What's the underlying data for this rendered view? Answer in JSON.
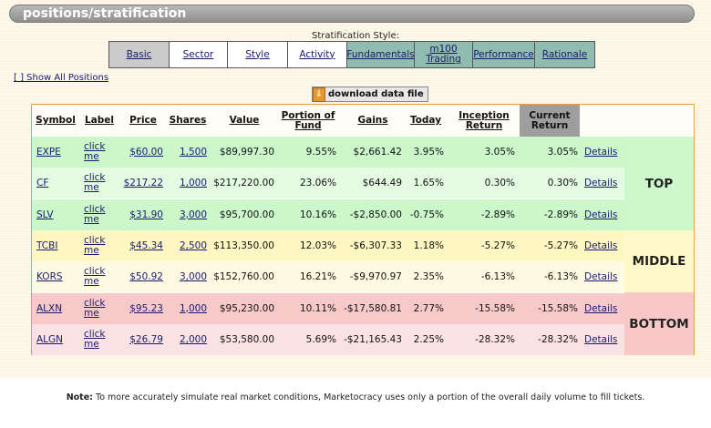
{
  "title": "positions/stratification",
  "stratification": {
    "label": "Stratification Style:",
    "tabs": [
      "Basic",
      "Sector",
      "Style",
      "Activity",
      "Fundamentals",
      "m100 Trading",
      "Performance",
      "Rationale"
    ],
    "selected": "Basic"
  },
  "show_all": "[ ] Show All Positions",
  "download_label": "download data file",
  "columns": [
    "Symbol",
    "Label",
    "Price",
    "Shares",
    "Value",
    "Portion of Fund",
    "Gains",
    "Today",
    "Inception Return",
    "Current Return"
  ],
  "rows": [
    {
      "symbol": "EXPE",
      "label": "click me",
      "price": "$60.00",
      "shares": "1,500",
      "value": "$89,997.30",
      "portion": "9.55%",
      "gains": "$2,661.42",
      "today": "3.95%",
      "inception": "3.05%",
      "current": "3.05%",
      "details": "Details"
    },
    {
      "symbol": "CF",
      "label": "click me",
      "price": "$217.22",
      "shares": "1,000",
      "value": "$217,220.00",
      "portion": "23.06%",
      "gains": "$644.49",
      "today": "1.65%",
      "inception": "0.30%",
      "current": "0.30%",
      "details": "Details"
    },
    {
      "symbol": "SLV",
      "label": "click me",
      "price": "$31.90",
      "shares": "3,000",
      "value": "$95,700.00",
      "portion": "10.16%",
      "gains": "-$2,850.00",
      "today": "-0.75%",
      "inception": "-2.89%",
      "current": "-2.89%",
      "details": "Details"
    },
    {
      "symbol": "TCBI",
      "label": "click me",
      "price": "$45.34",
      "shares": "2,500",
      "value": "$113,350.00",
      "portion": "12.03%",
      "gains": "-$6,307.33",
      "today": "1.18%",
      "inception": "-5.27%",
      "current": "-5.27%",
      "details": "Details"
    },
    {
      "symbol": "KORS",
      "label": "click me",
      "price": "$50.92",
      "shares": "3,000",
      "value": "$152,760.00",
      "portion": "16.21%",
      "gains": "-$9,970.97",
      "today": "2.35%",
      "inception": "-6.13%",
      "current": "-6.13%",
      "details": "Details"
    },
    {
      "symbol": "ALXN",
      "label": "click me",
      "price": "$95.23",
      "shares": "1,000",
      "value": "$95,230.00",
      "portion": "10.11%",
      "gains": "-$17,580.81",
      "today": "2.77%",
      "inception": "-15.58%",
      "current": "-15.58%",
      "details": "Details"
    },
    {
      "symbol": "ALGN",
      "label": "click me",
      "price": "$26.79",
      "shares": "2,000",
      "value": "$53,580.00",
      "portion": "5.69%",
      "gains": "-$21,165.43",
      "today": "2.25%",
      "inception": "-28.32%",
      "current": "-28.32%",
      "details": "Details"
    }
  ],
  "groups": [
    "TOP",
    "MIDDLE",
    "BOTTOM"
  ],
  "note": {
    "prefix": "Note:",
    "text": "To more accurately simulate real market conditions, Marketocracy uses only a portion of the overall daily volume to fill tickets."
  },
  "colors": {
    "top_dark": "#cbf7cb",
    "top_light": "#e4fbe2",
    "middle_dark": "#fff7c2",
    "middle_light": "#fffbe3",
    "bottom_dark": "#f8c9c9",
    "bottom_light": "#fbe2e2",
    "group_top": "#ccf8cc",
    "group_middle": "#fff8c8",
    "group_bottom": "#f8c8c8"
  }
}
